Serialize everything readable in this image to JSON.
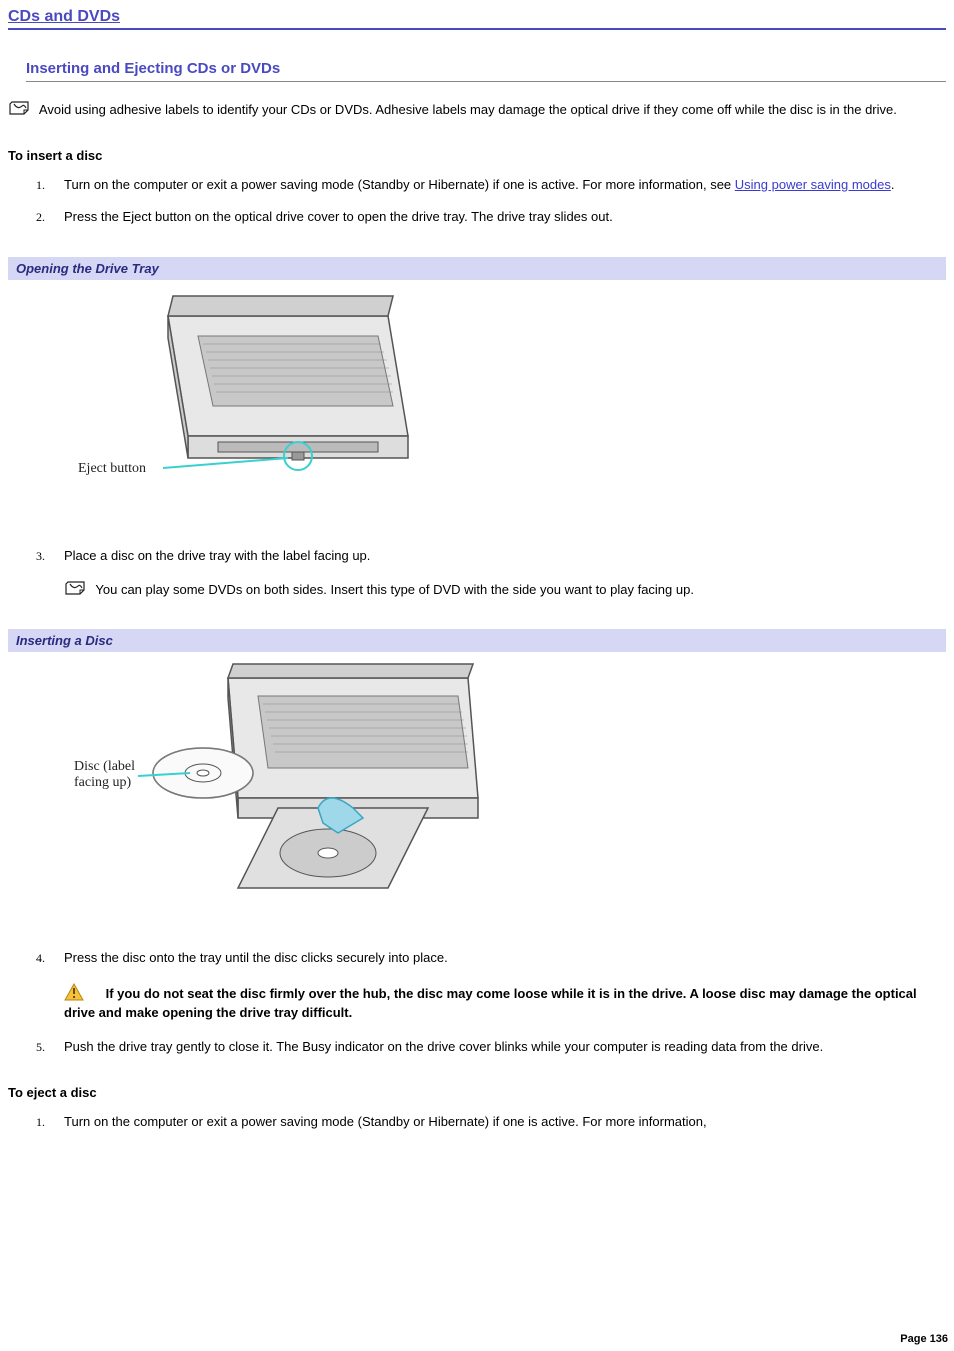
{
  "section_title": "CDs and DVDs",
  "subsection_title": "Inserting and Ejecting CDs or DVDs",
  "top_note": "Avoid using adhesive labels to identify your CDs or DVDs. Adhesive labels may damage the optical drive if they come off while the disc is in the drive.",
  "insert_heading": "To insert a disc",
  "steps_insert": {
    "s1_pre": "Turn on the computer or exit a power saving mode (Standby or Hibernate) if one is active. For more information, see ",
    "s1_link": "Using power saving modes",
    "s1_post": ".",
    "s2": "Press the Eject button on the optical drive cover to open the drive tray. The drive tray slides out.",
    "s3": "Place a disc on the drive tray with the label facing up.",
    "s3_note": "You can play some DVDs on both sides. Insert this type of DVD with the side you want to play facing up.",
    "s4": "Press the disc onto the tray until the disc clicks securely into place.",
    "s4_warn": "If you do not seat the disc firmly over the hub, the disc may come loose while it is in the drive. A loose disc may damage the optical drive and make opening the drive tray difficult.",
    "s5": "Push the drive tray gently to close it. The Busy indicator on the drive cover blinks while your computer is reading data from the drive."
  },
  "caption1": "Opening the Drive Tray",
  "fig1_label": "Eject button",
  "caption2": "Inserting a Disc",
  "fig2_label1": "Disc (label",
  "fig2_label2": "facing up)",
  "eject_heading": "To eject a disc",
  "steps_eject": {
    "e1": "Turn on the computer or exit a power saving mode (Standby or Hibernate) if one is active. For more information,"
  },
  "page_label": "Page 136"
}
